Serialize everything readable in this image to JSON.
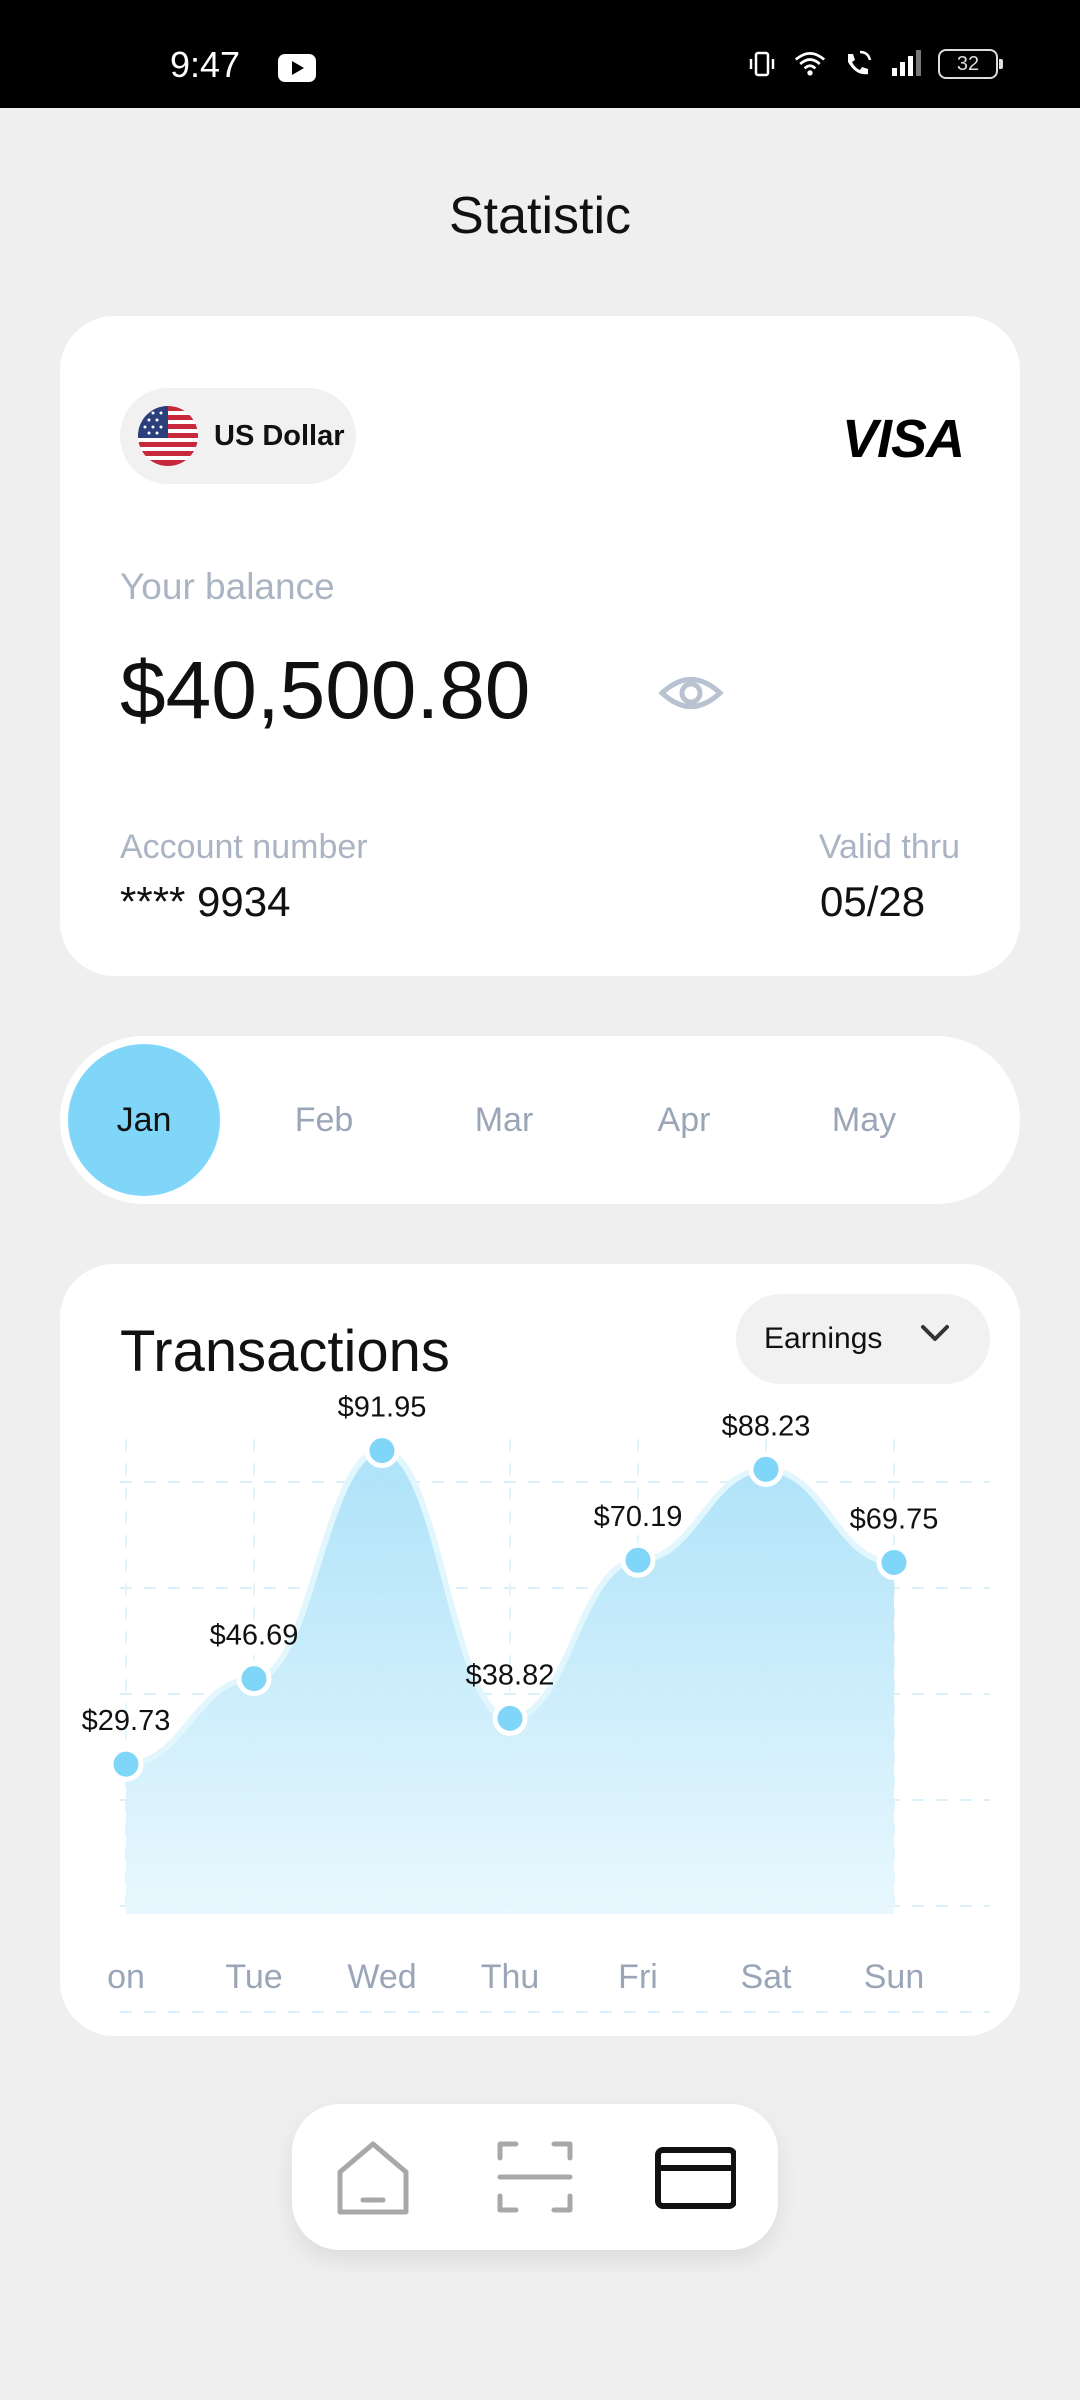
{
  "status_bar": {
    "time": "9:47",
    "battery": "32",
    "icons": [
      "youtube-icon",
      "vibrate-icon",
      "wifi-icon",
      "wifi-call-icon",
      "signal-icon",
      "battery-icon"
    ]
  },
  "header": {
    "title": "Statistic"
  },
  "balance_card": {
    "currency": "US Dollar",
    "card_brand": "VISA",
    "balance_label": "Your balance",
    "balance": "$40,500.80",
    "account_label": "Account number",
    "account_number": "**** 9934",
    "valid_label": "Valid thru",
    "valid_thru": "05/28"
  },
  "months": {
    "items": [
      "Jan",
      "Feb",
      "Mar",
      "Apr",
      "May"
    ],
    "selected": "Jan"
  },
  "transactions": {
    "title": "Transactions",
    "filter": "Earnings"
  },
  "chart_data": {
    "type": "area",
    "categories": [
      "on",
      "Tue",
      "Wed",
      "Thu",
      "Fri",
      "Sat",
      "Sun"
    ],
    "values": [
      29.73,
      46.69,
      91.95,
      38.82,
      70.19,
      88.23,
      69.75
    ],
    "labels": [
      "$29.73",
      "$46.69",
      "$91.95",
      "$38.82",
      "$70.19",
      "$88.23",
      "$69.75"
    ],
    "grid": true,
    "colors": {
      "fill": "#c9ecfb",
      "line": "#d6f2fd",
      "point": "#7fd6f8"
    }
  },
  "bottom_nav": {
    "items": [
      "home-icon",
      "scan-icon",
      "card-icon"
    ],
    "active": "card-icon"
  },
  "colors": {
    "accent": "#7fd6f8",
    "background": "#efefef",
    "muted_text": "#aab4c3"
  }
}
